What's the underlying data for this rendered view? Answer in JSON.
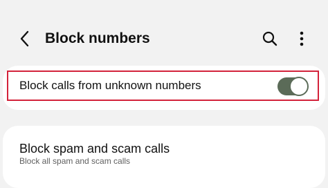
{
  "header": {
    "title": "Block numbers",
    "back_icon": "chevron-left-icon",
    "search_icon": "search-icon",
    "more_icon": "more-vertical-icon"
  },
  "settings": {
    "block_unknown": {
      "label": "Block calls from unknown numbers",
      "enabled": true
    },
    "block_spam": {
      "title": "Block spam and scam calls",
      "subtitle": "Block all spam and scam calls"
    }
  },
  "colors": {
    "background": "#f2f2f2",
    "card": "#ffffff",
    "toggle_on": "#5b6b58",
    "highlight": "#d3223a"
  }
}
